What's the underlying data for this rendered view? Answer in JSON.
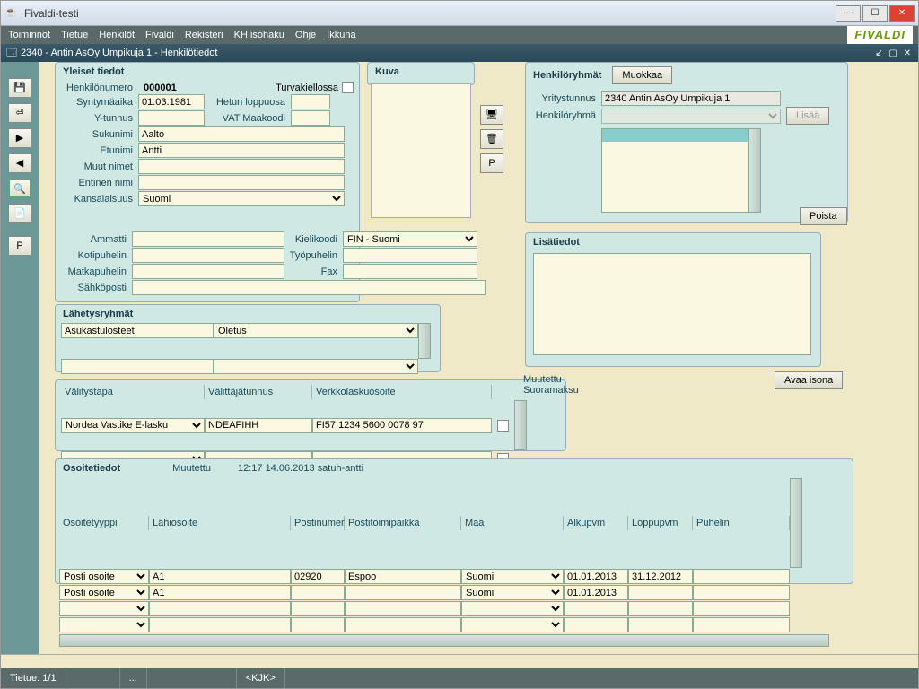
{
  "window": {
    "title": "Fivaldi-testi"
  },
  "menu": {
    "toiminnot": "Toiminnot",
    "tietue": "Tietue",
    "henkilot": "Henkilöt",
    "fivaldi": "Fivaldi",
    "rekisteri": "Rekisteri",
    "khisohaku": "KH isohaku",
    "ohje": "Ohje",
    "ikkuna": "Ikkuna",
    "brand": "FIVALDI"
  },
  "subwindow": {
    "title": "2340 - Antin AsOy Umpikuja 1 - Henkilötiedot"
  },
  "yleiset": {
    "title": "Yleiset tiedot",
    "henkilonumero_label": "Henkilönumero",
    "henkilonumero_value": "000001",
    "turvakiellossa_label": "Turvakiellossa",
    "syntymaaika_label": "Syntymäaika",
    "syntymaaika": "01.03.1981",
    "hetun_label": "Hetun loppuosa",
    "hetun": "",
    "ytunnus_label": "Y-tunnus",
    "ytunnus": "",
    "vat_label": "VAT Maakoodi",
    "vat": "",
    "sukunimi_label": "Sukunimi",
    "sukunimi": "Aalto",
    "etunimi_label": "Etunimi",
    "etunimi": "Antti",
    "muut_label": "Muut nimet",
    "muut": "",
    "entinen_label": "Entinen nimi",
    "entinen": "",
    "kansalaisuus_label": "Kansalaisuus",
    "kansalaisuus": "Suomi",
    "ammatti_label": "Ammatti",
    "ammatti": "",
    "kielikoodi_label": "Kielikoodi",
    "kielikoodi": "FIN - Suomi",
    "kotipuhelin_label": "Kotipuhelin",
    "tyopuhelin_label": "Työpuhelin",
    "matkapuhelin_label": "Matkapuhelin",
    "fax_label": "Fax",
    "sahkoposti_label": "Sähköposti"
  },
  "kuva": {
    "title": "Kuva",
    "p_btn": "P"
  },
  "henkiloryhmat": {
    "title": "Henkilöryhmät",
    "muokkaa_btn": "Muokkaa",
    "yritystunnus_label": "Yritystunnus",
    "yritystunnus": "2340 Antin AsOy Umpikuja 1",
    "henkiloryhma_label": "Henkilöryhmä",
    "lisaa_btn": "Lisää",
    "poista_btn": "Poista"
  },
  "lisatiedot": {
    "title": "Lisätiedot",
    "avaa_btn": "Avaa isona"
  },
  "lahetysryhmat": {
    "title": "Lähetysryhmät",
    "col1": "Asukastulosteet",
    "col2": "Oletus"
  },
  "verkkolaskut": {
    "valitystapa_label": "Välitystapa",
    "valittajatunnus_label": "Välittäjätunnus",
    "verkkolaskuosoite_label": "Verkkolaskuosoite",
    "muutettu_label": "Muutettu",
    "suoramaksu_label": "Suoramaksu",
    "valitystapa": "Nordea Vastike E-lasku",
    "valittajatunnus": "NDEAFIHH",
    "verkkolaskuosoite": "FI57 1234 5600 0078 97"
  },
  "osoitetiedot": {
    "title": "Osoitetiedot",
    "muutettu_label": "Muutettu",
    "muutettu_value": "12:17 14.06.2013 satuh-antti",
    "headers": {
      "osoitetyyppi": "Osoitetyyppi",
      "lahiosoite": "Lähiosoite",
      "postinumero": "Postinumero",
      "postitoimipaikka": "Postitoimipaikka",
      "maa": "Maa",
      "alkupvm": "Alkupvm",
      "loppupvm": "Loppupvm",
      "puhelin": "Puhelin"
    },
    "rows": [
      {
        "tyyppi": "Posti osoite",
        "lahi": "A1",
        "postinro": "02920",
        "paikka": "Espoo",
        "maa": "Suomi",
        "alku": "01.01.2013",
        "loppu": "31.12.2012",
        "puh": ""
      },
      {
        "tyyppi": "Posti osoite",
        "lahi": "A1",
        "postinro": "",
        "paikka": "",
        "maa": "Suomi",
        "alku": "01.01.2013",
        "loppu": "",
        "puh": ""
      }
    ]
  },
  "toolbar": {
    "p": "P"
  },
  "status": {
    "tietue": "Tietue: 1/1",
    "dots": "...",
    "kjk": "<KJK>"
  }
}
